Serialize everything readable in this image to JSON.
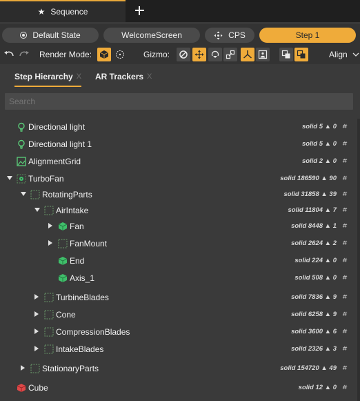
{
  "tab": {
    "title": "Sequence"
  },
  "states": {
    "default": "Default State",
    "welcome": "WelcomeScreen",
    "cps": "CPS",
    "step": "Step 1"
  },
  "toolbar": {
    "render_mode_label": "Render Mode:",
    "gizmo_label": "Gizmo:",
    "align_label": "Align"
  },
  "panel_tabs": [
    {
      "label": "Step Hierarchy",
      "close": "X"
    },
    {
      "label": "AR Trackers",
      "close": "X"
    }
  ],
  "search": {
    "placeholder": "Search"
  },
  "tree": [
    {
      "name": "Directional light",
      "meta": "solid 5 ▲ 0",
      "icon": "light-bulb-icon"
    },
    {
      "name": "Directional light 1",
      "meta": "solid 5 ▲ 0",
      "icon": "light-bulb-icon"
    },
    {
      "name": "AlignmentGrid",
      "meta": "solid 2 ▲ 0",
      "icon": "image-icon"
    },
    {
      "name": "TurboFan",
      "meta": "solid 186590 ▲ 90",
      "icon": "group-gear-icon"
    },
    {
      "name": "RotatingParts",
      "meta": "solid 31858 ▲ 39",
      "icon": "empty-group-icon"
    },
    {
      "name": "AirIntake",
      "meta": "solid 11804 ▲ 7",
      "icon": "empty-group-icon"
    },
    {
      "name": "Fan",
      "meta": "solid 8448 ▲ 1",
      "icon": "cube-icon"
    },
    {
      "name": "FanMount",
      "meta": "solid 2624 ▲ 2",
      "icon": "empty-group-icon"
    },
    {
      "name": "End",
      "meta": "solid 224 ▲ 0",
      "icon": "cube-icon"
    },
    {
      "name": "Axis_1",
      "meta": "solid 508 ▲ 0",
      "icon": "cube-icon"
    },
    {
      "name": "TurbineBlades",
      "meta": "solid 7836 ▲ 9",
      "icon": "empty-group-icon"
    },
    {
      "name": "Cone",
      "meta": "solid 6258 ▲ 9",
      "icon": "empty-group-icon"
    },
    {
      "name": "CompressionBlades",
      "meta": "solid 3600 ▲ 6",
      "icon": "empty-group-icon"
    },
    {
      "name": "IntakeBlades",
      "meta": "solid 2326 ▲ 3",
      "icon": "empty-group-icon"
    },
    {
      "name": "StationaryParts",
      "meta": "solid 154720 ▲ 49",
      "icon": "empty-group-icon"
    },
    {
      "name": "Cube",
      "meta": "solid 12 ▲ 0",
      "icon": "cube-red-icon"
    }
  ],
  "colors": {
    "accent": "#efab3a",
    "cube_green": "#3fbf6a",
    "cube_red": "#e04848",
    "light_green": "#5bd07a"
  }
}
